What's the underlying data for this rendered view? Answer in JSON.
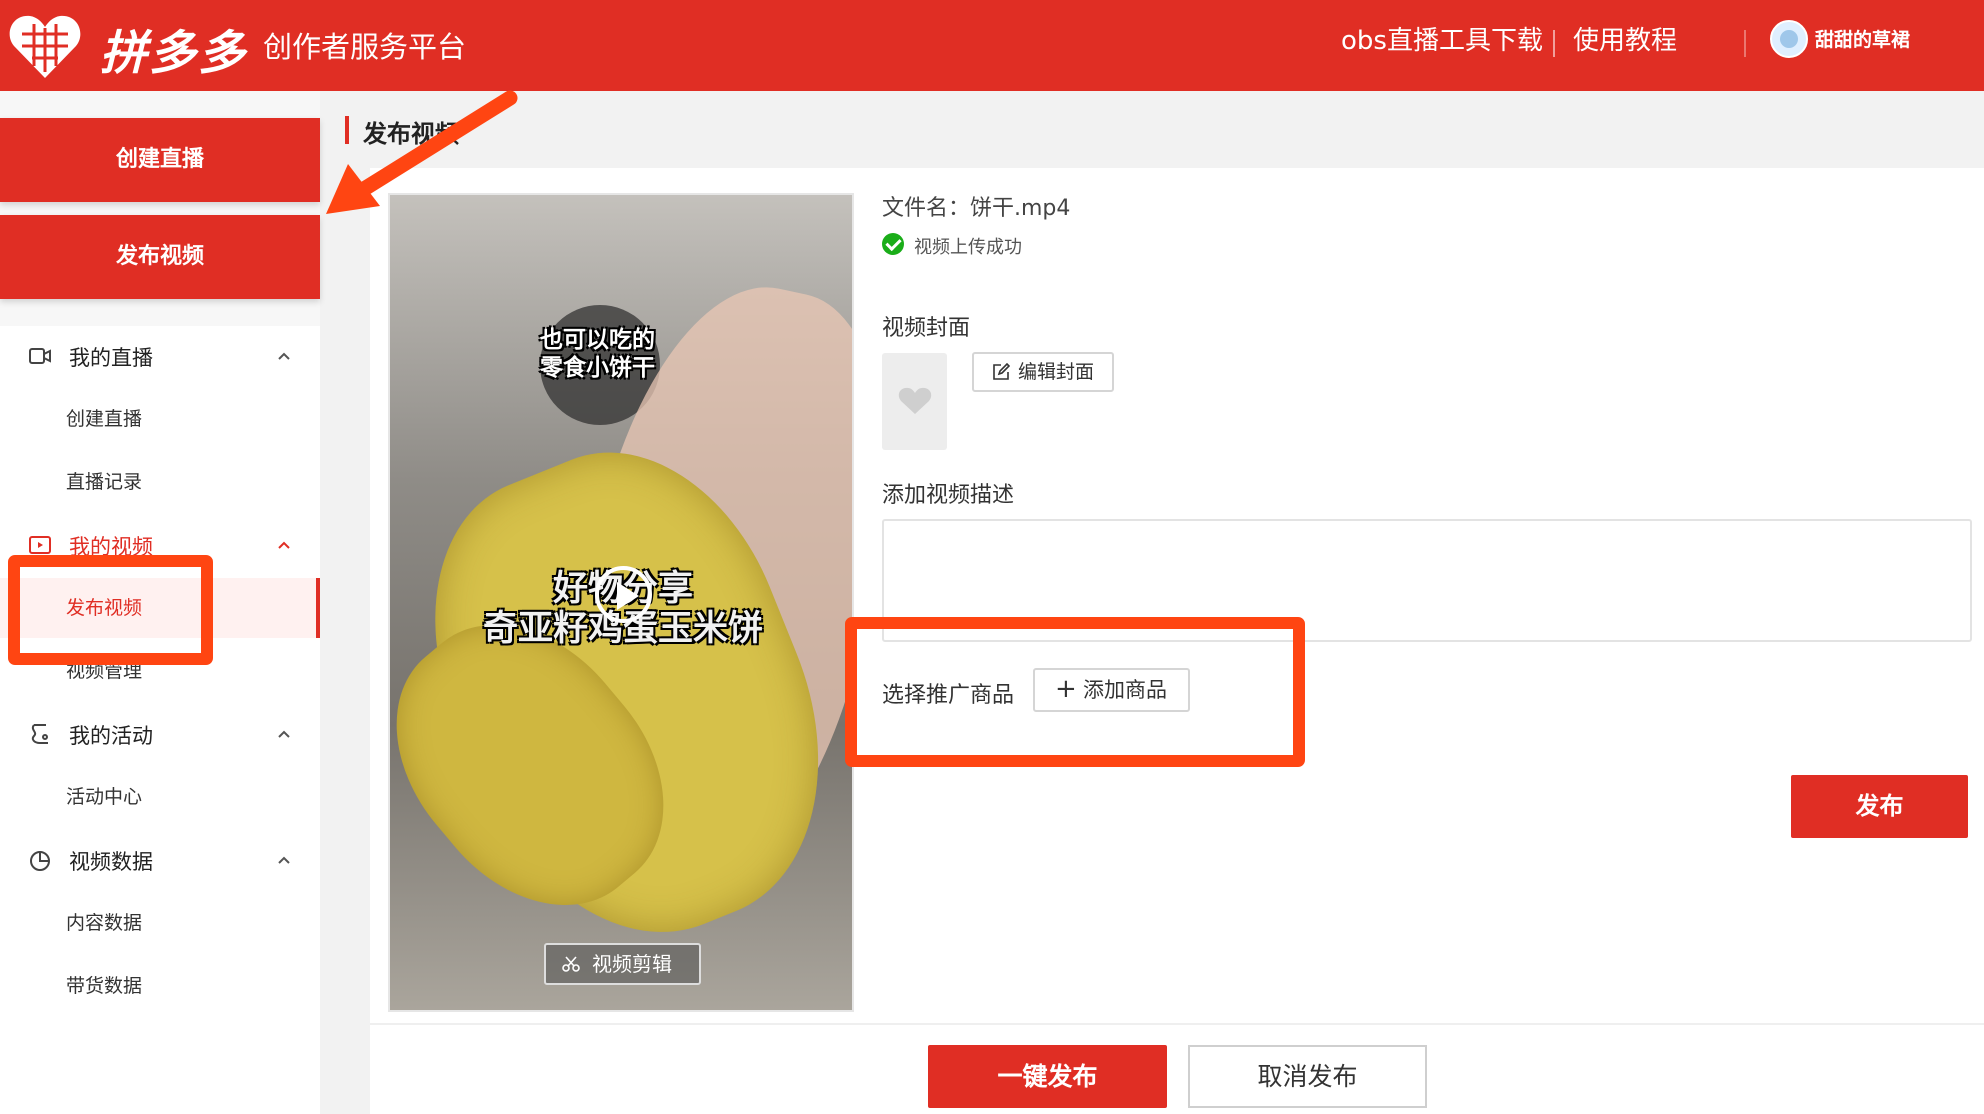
{
  "header": {
    "brand_name": "拼多多",
    "brand_sub": "创作者服务平台",
    "links": {
      "obs": "obs直播工具下载",
      "tutorial": "使用教程"
    },
    "username": "甜甜的草裙",
    "bg_color": "#e02e24"
  },
  "sidebar": {
    "create_live_button": "创建直播",
    "publish_video_button": "发布视频",
    "groups": {
      "live": {
        "title": "我的直播",
        "icon": "video-camera-icon",
        "items": [
          "创建直播",
          "直播记录"
        ]
      },
      "video": {
        "title": "我的视频",
        "icon": "play-box-icon",
        "items": [
          "发布视频",
          "视频管理"
        ],
        "active_item": "发布视频"
      },
      "activity": {
        "title": "我的活动",
        "icon": "activity-icon",
        "items": [
          "活动中心"
        ]
      },
      "stats": {
        "title": "视频数据",
        "icon": "pie-chart-icon",
        "items": [
          "内容数据",
          "带货数据"
        ]
      }
    }
  },
  "main": {
    "section_title": "发布视频",
    "video": {
      "caption_small": [
        "也可以吃的",
        "零食小饼干"
      ],
      "caption_big": [
        "好物分享",
        "奇亚籽鸡蛋玉米饼"
      ],
      "edit_button": "视频剪辑"
    },
    "file_name": "文件名：饼干.mp4",
    "upload_status": "视频上传成功",
    "cover_label": "视频封面",
    "edit_cover_button": "编辑封面",
    "desc_label": "添加视频描述",
    "desc_value": "",
    "goods_label": "选择推广商品",
    "add_goods_button": "添加商品",
    "publish_button": "发布",
    "one_click_publish": "一键发布",
    "cancel_publish": "取消发布"
  },
  "colors": {
    "accent": "#e02e24",
    "annotation": "#ff4512",
    "success": "#1aad19"
  }
}
